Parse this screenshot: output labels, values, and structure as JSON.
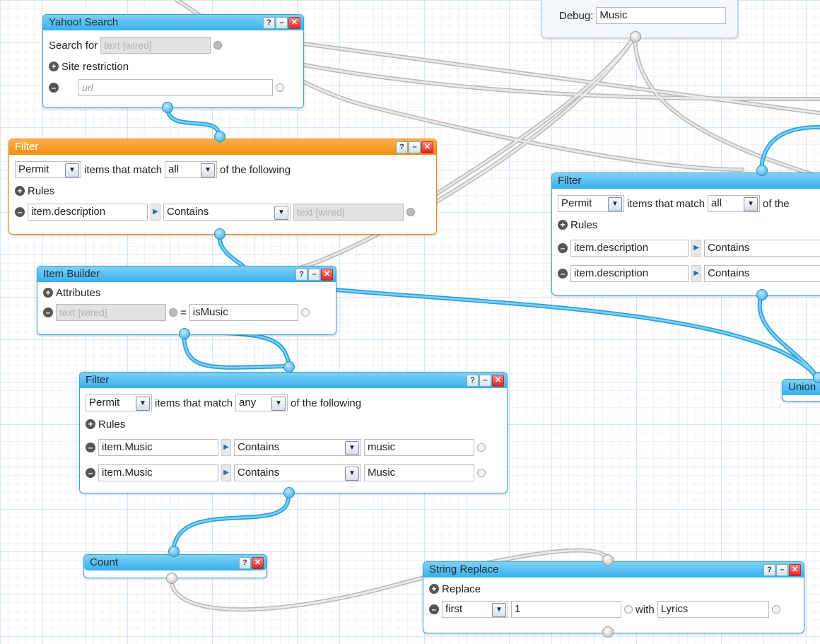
{
  "modules": {
    "yahoo": {
      "title": "Yahoo! Search",
      "search_for_label": "Search for",
      "search_for_value": "text [wired]",
      "site_restriction_label": "Site restriction",
      "url_placeholder": "url"
    },
    "filter1": {
      "title": "Filter",
      "mode": "Permit",
      "items_label": "items that match",
      "match": "all",
      "following": "of the following",
      "rules_label": "Rules",
      "rules": [
        {
          "field": "item.description",
          "op": "Contains",
          "value": "text [wired]"
        }
      ]
    },
    "item_builder": {
      "title": "Item Builder",
      "attributes_label": "Attributes",
      "key": "text [wired]",
      "eq": "=",
      "value": "isMusic"
    },
    "filter2": {
      "title": "Filter",
      "mode": "Permit",
      "items_label": "items that match",
      "match": "any",
      "following": "of the following",
      "rules_label": "Rules",
      "rules": [
        {
          "field": "item.Music",
          "op": "Contains",
          "value": "music"
        },
        {
          "field": "item.Music",
          "op": "Contains",
          "value": "Music"
        }
      ]
    },
    "count": {
      "title": "Count"
    },
    "string_replace": {
      "title": "String Replace",
      "replace_label": "Replace",
      "which": "first",
      "value": "1",
      "with_label": "with",
      "with_value": "Lyrics"
    },
    "debug": {
      "label": "Debug:",
      "value": "Music"
    },
    "filter3": {
      "title": "Filter",
      "mode": "Permit",
      "items_label": "items that match",
      "match": "all",
      "following": "of the",
      "rules_label": "Rules",
      "rules": [
        {
          "field": "item.description",
          "op": "Contains"
        },
        {
          "field": "item.description",
          "op": "Contains"
        }
      ]
    },
    "union": {
      "title": "Union"
    }
  },
  "title_buttons": {
    "help": "?",
    "minimize": "–",
    "close": "✕"
  },
  "icons": {
    "plus": "plus-circle-icon",
    "minus": "minus-circle-icon",
    "dropdown": "chevron-down-icon",
    "arrow": "triangle-right-icon"
  },
  "colors": {
    "title_blue": "#36b0ec",
    "title_orange": "#f38d12",
    "wire_blue": "#3ab3ea",
    "wire_grey": "#c8c8c8"
  }
}
